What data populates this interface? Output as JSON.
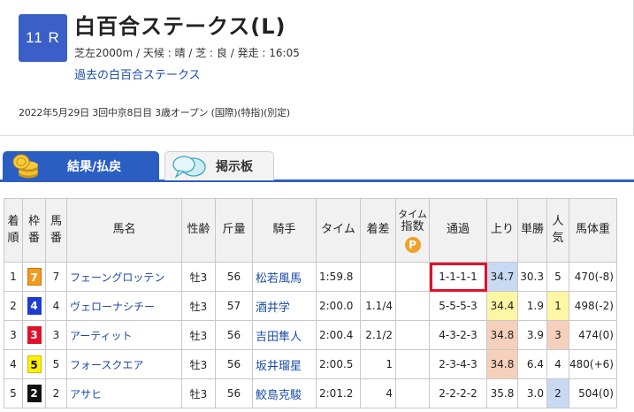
{
  "header": {
    "race_number": "11 R",
    "title": "白百合ステークス(L)",
    "conditions": "芝左2000m / 天候 : 晴 / 芝 : 良 / 発走 : 16:05",
    "past_link": "過去の白百合ステークス",
    "info": "2022年5月29日 3回中京8日目 3歳オープン (国際)(特指)(別定)"
  },
  "tabs": [
    {
      "label": "結果/払戻",
      "icon": "coins-icon",
      "active": true
    },
    {
      "label": "掲示板",
      "icon": "speech-bubble-icon",
      "active": false
    }
  ],
  "table": {
    "headers": {
      "rank": [
        "着",
        "順"
      ],
      "waku": [
        "枠",
        "番"
      ],
      "umaban": [
        "馬",
        "番"
      ],
      "name": "馬名",
      "sexage": "性齢",
      "weight": "斤量",
      "jockey": "騎手",
      "time": "タイム",
      "margin": "着差",
      "time_index": [
        "タイム",
        "指数"
      ],
      "time_index_badge": "P",
      "passing": "通過",
      "last3f": "上り",
      "odds": "単勝",
      "popularity": [
        "人",
        "気"
      ],
      "body_weight": "馬体重"
    },
    "rows": [
      {
        "rank": "1",
        "waku": "7",
        "umaban": "7",
        "name": "フェーングロッテン",
        "sexage": "牡3",
        "weight": "56",
        "jockey": "松若風馬",
        "time": "1:59.8",
        "margin": "",
        "passing": "1-1-1-1",
        "last3f": "34.7",
        "odds": "30.3",
        "popularity": "5",
        "body_weight": "470(-8)"
      },
      {
        "rank": "2",
        "waku": "4",
        "umaban": "4",
        "name": "ヴェローナシチー",
        "sexage": "牡3",
        "weight": "57",
        "jockey": "酒井学",
        "time": "2:00.0",
        "margin": "1.1/4",
        "passing": "5-5-5-3",
        "last3f": "34.4",
        "odds": "1.9",
        "popularity": "1",
        "body_weight": "498(-2)"
      },
      {
        "rank": "3",
        "waku": "3",
        "umaban": "3",
        "name": "アーティット",
        "sexage": "牡3",
        "weight": "56",
        "jockey": "吉田隼人",
        "time": "2:00.4",
        "margin": "2.1/2",
        "passing": "4-3-2-3",
        "last3f": "34.8",
        "odds": "3.9",
        "popularity": "3",
        "body_weight": "474(0)"
      },
      {
        "rank": "4",
        "waku": "5",
        "umaban": "5",
        "name": "フォースクエア",
        "sexage": "牡3",
        "weight": "56",
        "jockey": "坂井瑠星",
        "time": "2:00.5",
        "margin": "1",
        "passing": "2-3-4-3",
        "last3f": "34.8",
        "odds": "6.4",
        "popularity": "4",
        "body_weight": "480(+6)"
      },
      {
        "rank": "5",
        "waku": "2",
        "umaban": "2",
        "name": "アサヒ",
        "sexage": "牡3",
        "weight": "56",
        "jockey": "鮫島克駿",
        "time": "2:01.2",
        "margin": "4",
        "passing": "2-2-2-2",
        "last3f": "35.8",
        "odds": "3.0",
        "popularity": "2",
        "body_weight": "504(0)"
      }
    ]
  },
  "colors": {
    "accent_blue": "#2b5ec2",
    "link_blue": "#1a4ba8",
    "highlight_red": "#e0112b",
    "top3_last3f": "#f6d0bb",
    "fastest_last3f": "#c7d9f3",
    "pop1": "#fdf6a5",
    "waku_7": "#f39a1e",
    "waku_4": "#1f3bd1",
    "waku_3": "#e0112b",
    "waku_5": "#fff000",
    "waku_2": "#111111"
  }
}
